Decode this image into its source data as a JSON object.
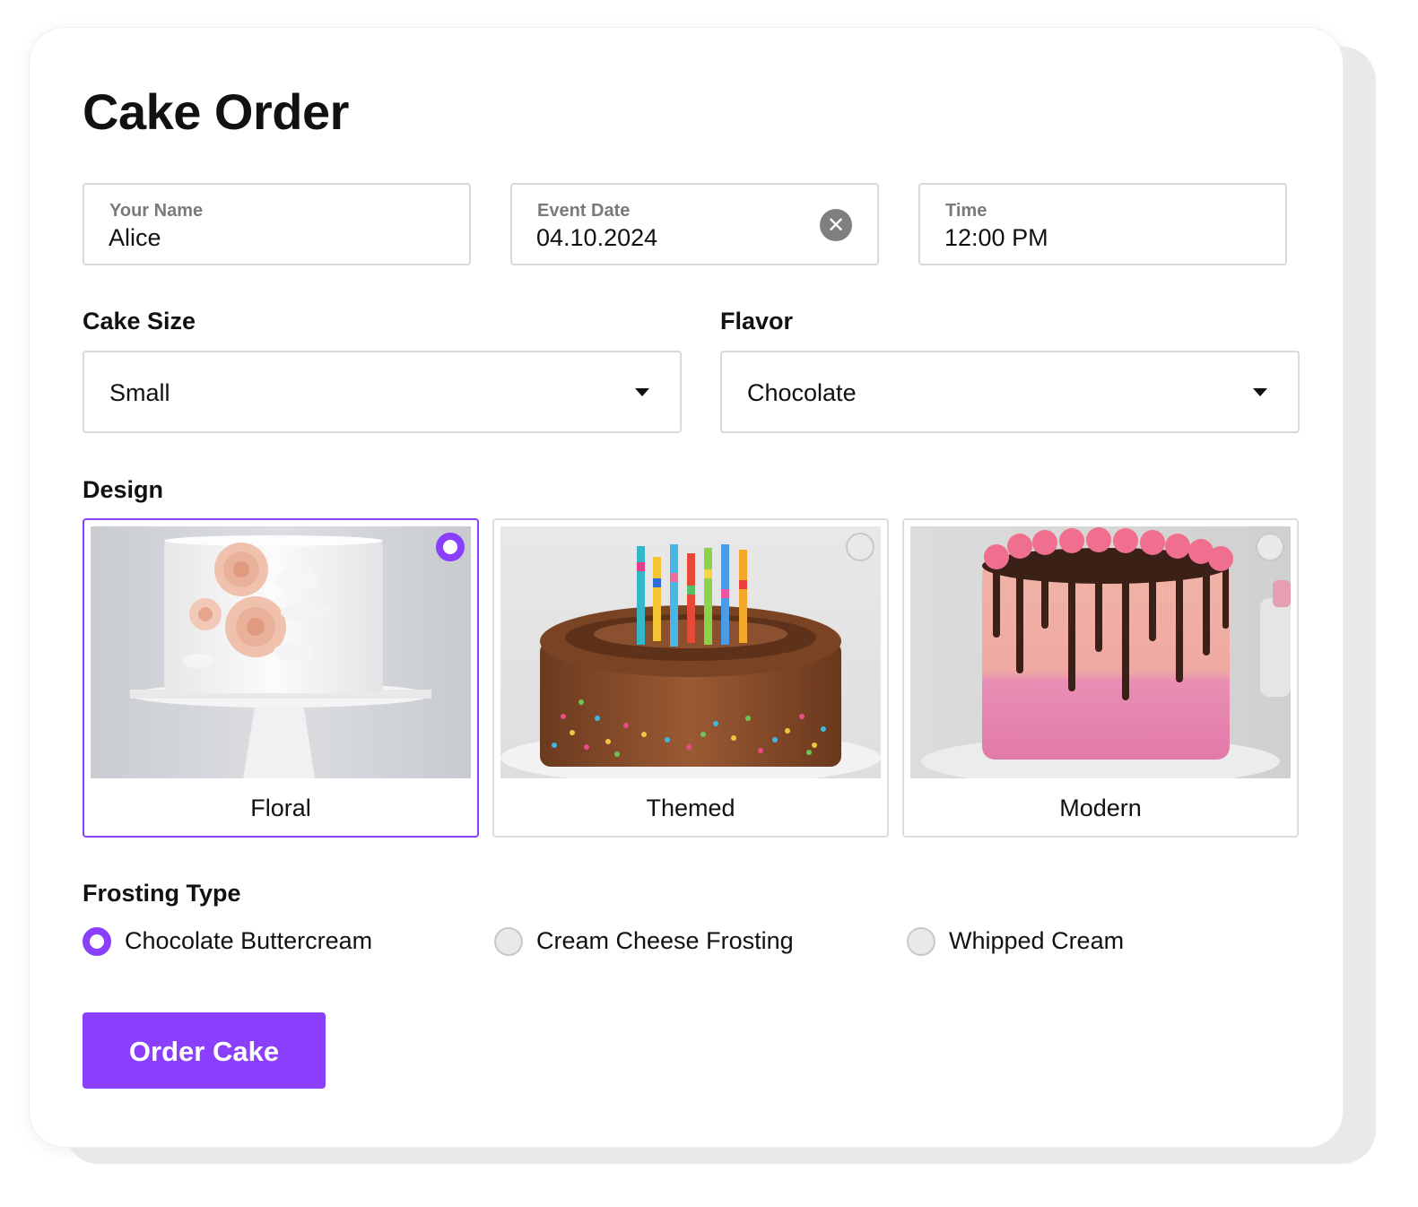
{
  "form": {
    "title": "Cake Order",
    "name_field": {
      "label": "Your Name",
      "value": "Alice"
    },
    "date_field": {
      "label": "Event Date",
      "value": "04.10.2024",
      "clear_icon": "close-circle-icon"
    },
    "time_field": {
      "label": "Time",
      "value": "12:00 PM"
    },
    "size": {
      "label": "Cake Size",
      "value": "Small",
      "icon": "caret-down-icon"
    },
    "flavor": {
      "label": "Flavor",
      "value": "Chocolate",
      "icon": "caret-down-icon"
    },
    "design": {
      "label": "Design",
      "options": [
        {
          "label": "Floral",
          "selected": true
        },
        {
          "label": "Themed",
          "selected": false
        },
        {
          "label": "Modern",
          "selected": false
        }
      ]
    },
    "frosting": {
      "label": "Frosting Type",
      "options": [
        {
          "label": "Chocolate Buttercream",
          "selected": true
        },
        {
          "label": "Cream Cheese Frosting",
          "selected": false
        },
        {
          "label": "Whipped Cream",
          "selected": false
        }
      ]
    },
    "submit_label": "Order Cake"
  },
  "colors": {
    "accent": "#8a3ffc",
    "border": "#d9d9d9",
    "text": "#111111",
    "muted_label": "#7a7a7a"
  }
}
